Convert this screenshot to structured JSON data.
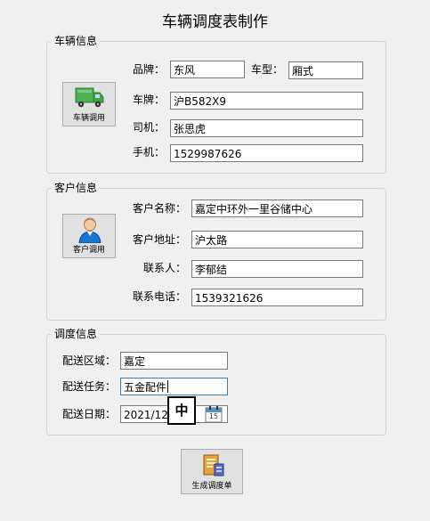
{
  "title": "车辆调度表制作",
  "vehicle": {
    "legend": "车辆信息",
    "button_label": "车辆调用",
    "brand_label": "品牌：",
    "brand_value": "东风",
    "type_label": "车型：",
    "type_value": "厢式",
    "plate_label": "车牌：",
    "plate_value": "沪B582X9",
    "driver_label": "司机：",
    "driver_value": "张思虎",
    "phone_label": "手机：",
    "phone_value": "1529987626"
  },
  "customer": {
    "legend": "客户信息",
    "button_label": "客户调用",
    "name_label": "客户名称：",
    "name_value": "嘉定中环外一里谷储中心",
    "address_label": "客户地址：",
    "address_value": "沪太路",
    "contact_label": "联系人：",
    "contact_value": "李郁结",
    "phone_label": "联系电话：",
    "phone_value": "1539321626"
  },
  "dispatch": {
    "legend": "调度信息",
    "area_label": "配送区域：",
    "area_value": "嘉定",
    "task_label": "配送任务：",
    "task_value": "五金配件",
    "date_label": "配送日期：",
    "date_value": "2021/12",
    "calendar_day": "15",
    "ime_indicator": "中"
  },
  "generate_button_label": "生成调度单"
}
